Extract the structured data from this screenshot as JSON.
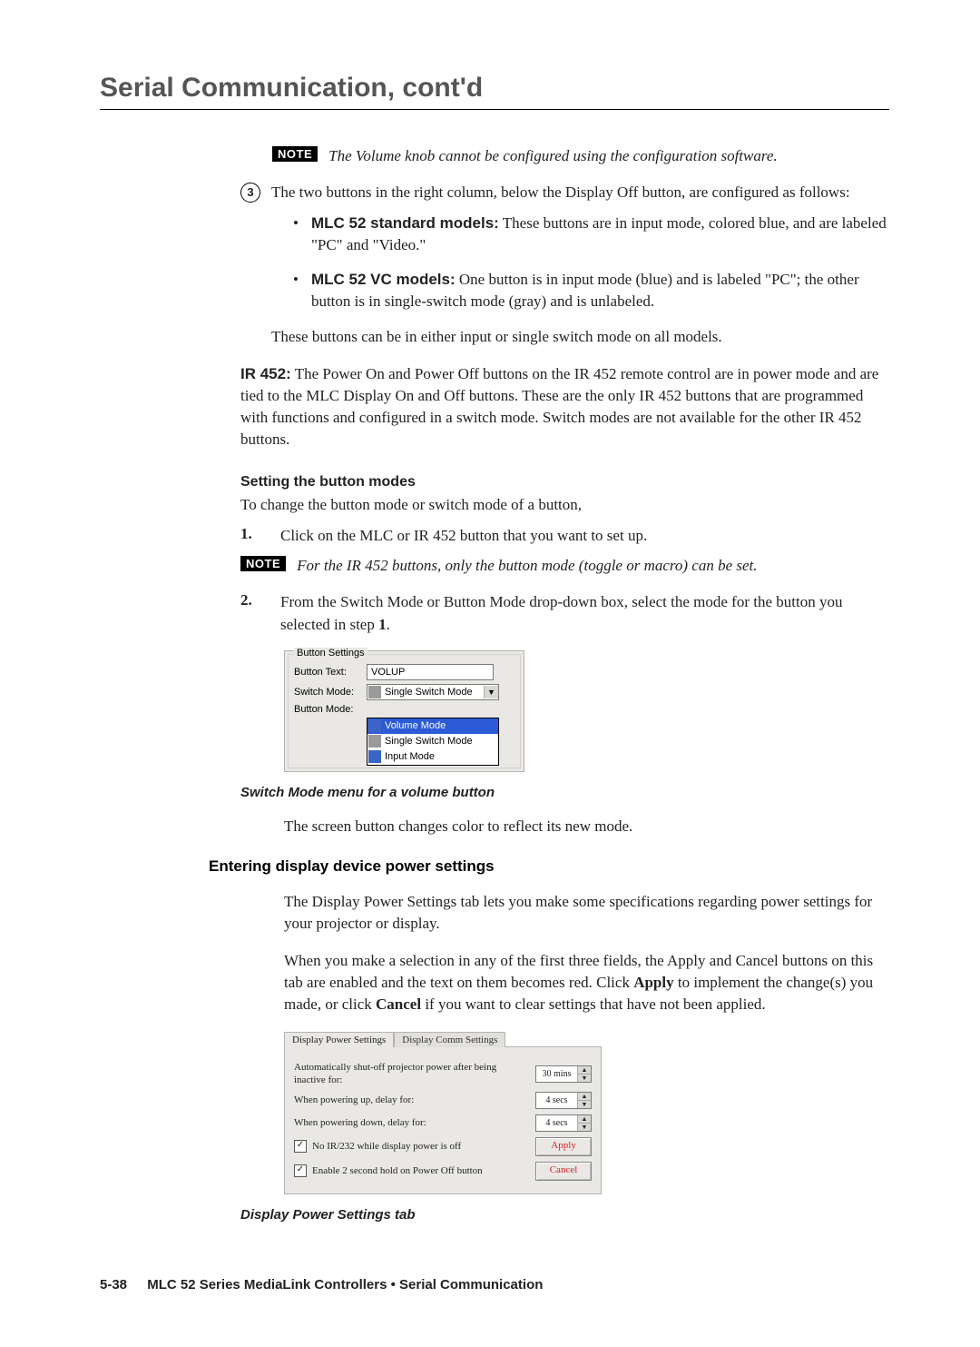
{
  "chapter_title": "Serial Communication, cont'd",
  "note1": {
    "badge": "NOTE",
    "text": "The Volume knob cannot be configured using the configuration software."
  },
  "step3": {
    "num": "3",
    "lead": "The two buttons in the right column, below the Display Off button, are configured as follows:",
    "bullets": [
      {
        "label": "MLC 52 standard models:",
        "rest": "  These buttons are in input mode, colored blue, and are labeled \"PC\" and \"Video.\""
      },
      {
        "label": "MLC 52 VC models:",
        "rest": "  One button is in input mode (blue) and is labeled \"PC\"; the other button is in single-switch mode (gray) and is unlabeled."
      }
    ],
    "after": "These buttons can be in either input or single switch mode on all models."
  },
  "ir452": {
    "label": "IR 452:",
    "rest": "  The Power On and Power Off buttons on the IR 452 remote control are in power mode and are tied to the MLC Display On and Off buttons.  These are the only IR 452 buttons that are programmed with functions and configured in a switch mode.  Switch modes are not available for the other IR 452 buttons."
  },
  "setting_modes": {
    "heading": "Setting the button modes",
    "intro": "To change the button mode or switch mode of a button,",
    "steps": [
      {
        "n": "1",
        "text": ".",
        "body": "Click on the MLC or IR 452 button that you want to set up."
      }
    ],
    "note": {
      "badge": "NOTE",
      "text": "For the IR 452 buttons, only the button mode (toggle or macro) can be set."
    },
    "step2": {
      "n": "2",
      "body_pre": "From the Switch Mode or Button Mode drop-down box, select the mode for the button you selected in step ",
      "bold": "1",
      "post": "."
    }
  },
  "ui1": {
    "legend": "Button Settings",
    "rows": {
      "text_label": "Button Text:",
      "text_value": "VOLUP",
      "switch_label": "Switch Mode:",
      "switch_value": "Single Switch Mode",
      "btnmode_label": "Button Mode:"
    },
    "dropdown": [
      {
        "swatch": "blue",
        "label": "Volume Mode",
        "sel": true
      },
      {
        "swatch": "gray",
        "label": "Single Switch Mode",
        "sel": false
      },
      {
        "swatch": "blue",
        "label": "Input Mode",
        "sel": false
      }
    ]
  },
  "caption1": "Switch Mode menu for a volume button",
  "after_ui1": "The screen button changes color to reflect its new mode.",
  "section2": {
    "heading": "Entering display device power settings",
    "p1": "The Display Power Settings tab lets you make some specifications regarding power settings for your projector or display.",
    "p2_pre": "When you make a selection in any of the first three fields, the Apply and Cancel buttons on this tab are enabled and the text on them becomes red.  Click ",
    "p2_b1": "Apply",
    "p2_mid": " to implement the change(s) you made, or click ",
    "p2_b2": "Cancel",
    "p2_post": " if you want to clear settings that have not been applied."
  },
  "ui2": {
    "tabs": [
      "Display Power Settings",
      "Display Comm Settings"
    ],
    "rows": [
      {
        "label": "Automatically shut-off projector power after being inactive for:",
        "value": "30 mins"
      },
      {
        "label": "When powering up, delay for:",
        "value": "4 secs"
      },
      {
        "label": "When powering down, delay for:",
        "value": "4 secs"
      }
    ],
    "checks": [
      {
        "checked": true,
        "label": "No IR/232 while display power is off",
        "btn": "Apply"
      },
      {
        "checked": true,
        "label": "Enable 2 second hold on Power Off button",
        "btn": "Cancel"
      }
    ]
  },
  "caption2": "Display Power Settings tab",
  "footer": {
    "page": "5-38",
    "text": "MLC 52 Series MediaLink Controllers • Serial Communication"
  }
}
